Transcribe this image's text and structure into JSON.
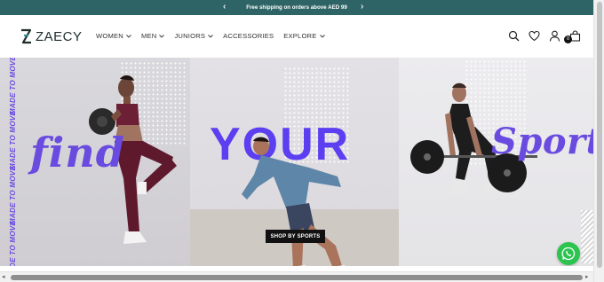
{
  "announcement": {
    "text": "Free shipping on orders above AED 99",
    "prev": "‹",
    "next": "›"
  },
  "brand": {
    "name": "ZAECY"
  },
  "nav": [
    {
      "label": "WOMEN",
      "dropdown": true
    },
    {
      "label": "MEN",
      "dropdown": true
    },
    {
      "label": "JUNIORS",
      "dropdown": true
    },
    {
      "label": "ACCESSORIES",
      "dropdown": false
    },
    {
      "label": "EXPLORE",
      "dropdown": true
    }
  ],
  "header_icons": [
    "search-icon",
    "wishlist-heart-icon",
    "account-icon",
    "cart-bag-icon"
  ],
  "cart": {
    "count": "0"
  },
  "hero": {
    "side_text": [
      "MADE TO MOVE",
      "MADE TO MOVE",
      "MADE TO MOVE",
      "MADE TO MOVE"
    ],
    "word_left": "find",
    "word_center": "YOUR",
    "word_right": "Sport",
    "cta_label": "SHOP BY SPORTS"
  },
  "colors": {
    "announce_bg": "#2f6466",
    "accent": "#6a4be0",
    "cta_bg": "#111111",
    "whatsapp": "#2cc44f"
  }
}
